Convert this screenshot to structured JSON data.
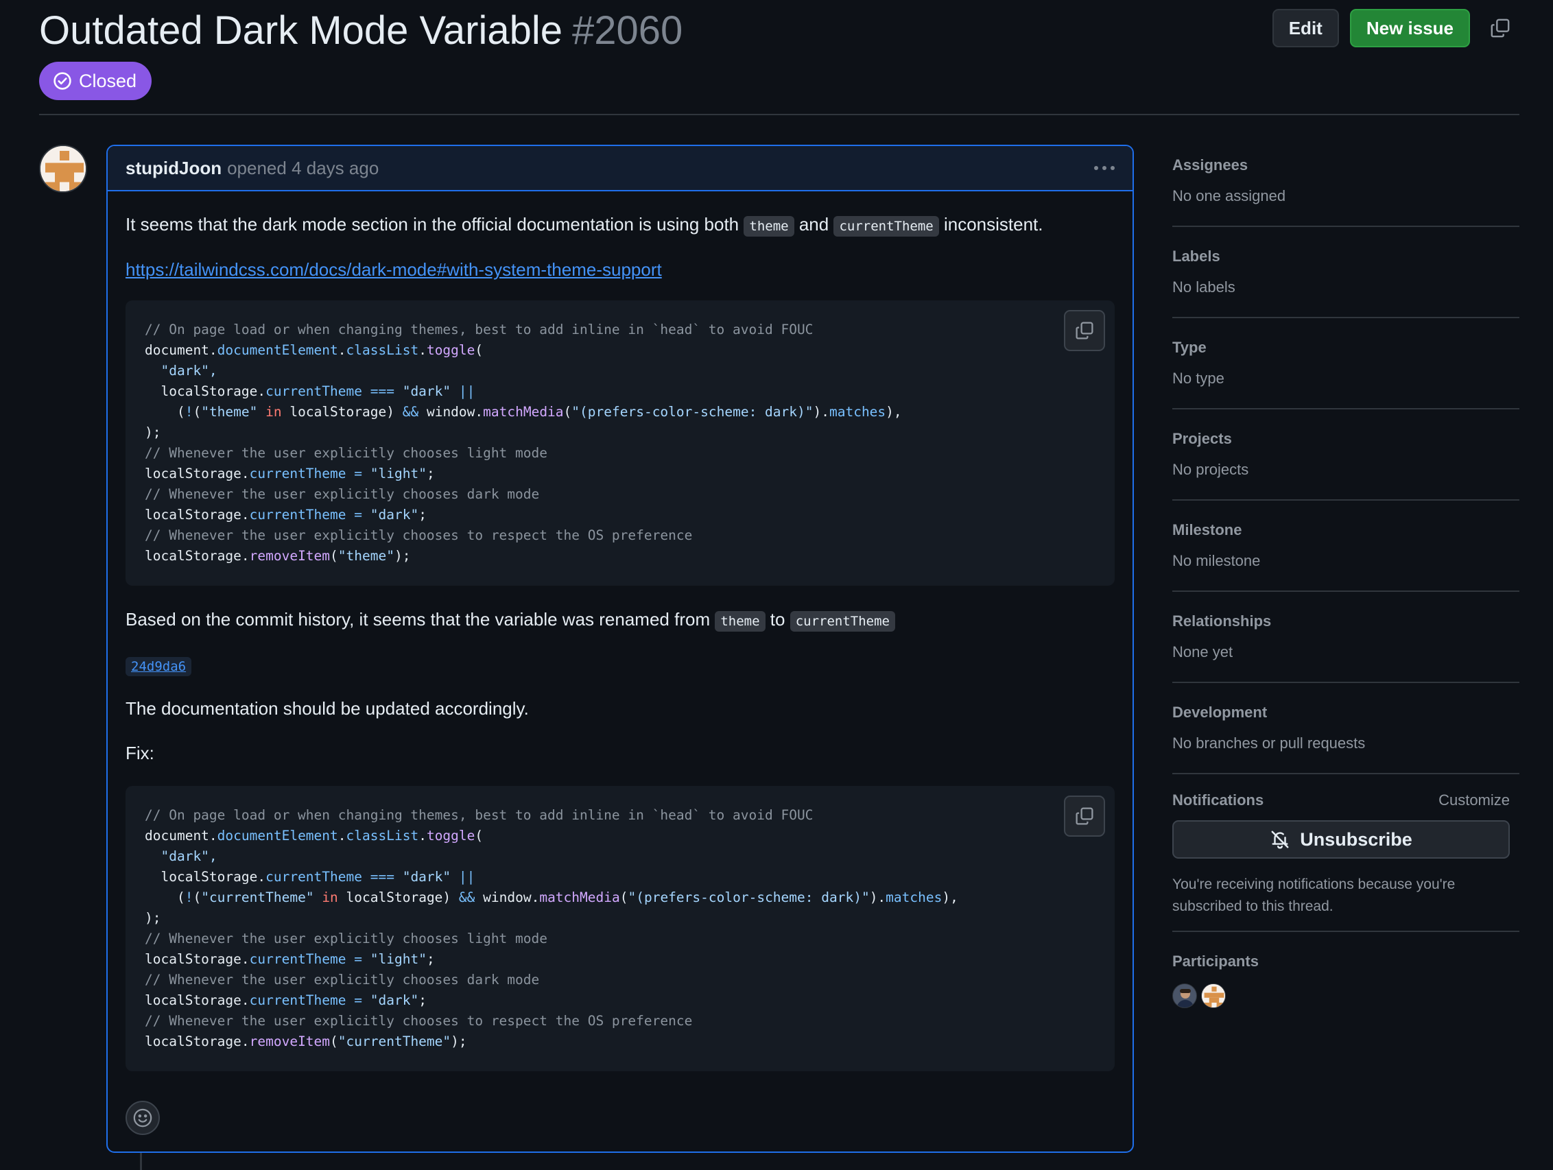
{
  "issue": {
    "title": "Outdated Dark Mode Variable",
    "number": "#2060",
    "state": "Closed",
    "state_color": "#8957e5"
  },
  "header_actions": {
    "edit_label": "Edit",
    "new_issue_label": "New issue"
  },
  "comment": {
    "author": "stupidJoon",
    "meta": "opened 4 days ago",
    "p1_before": "It seems that the dark mode section in the official documentation is using both",
    "p1_code1": "theme",
    "p1_mid": "and",
    "p1_code2": "currentTheme",
    "p1_after": "inconsistent.",
    "link": "https://tailwindcss.com/docs/dark-mode#with-system-theme-support",
    "code1": {
      "l1": "// On page load or when changing themes, best to add inline in `head` to avoid FOUC",
      "l2a": "document.",
      "l2b": "documentElement",
      "l2c": ".",
      "l2d": "classList",
      "l2e": ".",
      "l2f": "toggle",
      "l2g": "(",
      "l3": "  \"dark\",",
      "l4a": "  localStorage.",
      "l4b": "currentTheme",
      "l4c": " === ",
      "l4d": "\"dark\"",
      "l4e": " ||",
      "l5a": "    (",
      "l5b": "!",
      "l5c": "(",
      "l5d": "\"theme\"",
      "l5e": " in ",
      "l5f": "localStorage) ",
      "l5g": "&&",
      "l5h": " window.",
      "l5i": "matchMedia",
      "l5j": "(",
      "l5k": "\"(prefers-color-scheme: dark)\"",
      "l5l": ").",
      "l5m": "matches",
      "l5n": "),",
      "l6": ");",
      "l7": "// Whenever the user explicitly chooses light mode",
      "l8a": "localStorage.",
      "l8b": "currentTheme",
      "l8c": " = ",
      "l8d": "\"light\"",
      "l8e": ";",
      "l9": "// Whenever the user explicitly chooses dark mode",
      "l10a": "localStorage.",
      "l10b": "currentTheme",
      "l10c": " = ",
      "l10d": "\"dark\"",
      "l10e": ";",
      "l11": "// Whenever the user explicitly chooses to respect the OS preference",
      "l12a": "localStorage.",
      "l12b": "removeItem",
      "l12c": "(",
      "l12d": "\"theme\"",
      "l12e": ");"
    },
    "p2_before": "Based on the commit history, it seems that the variable was renamed from",
    "p2_code1": "theme",
    "p2_mid": "to",
    "p2_code2": "currentTheme",
    "commit_sha": "24d9da6",
    "p3": "The documentation should be updated accordingly.",
    "p4": "Fix:",
    "code2": {
      "l1": "// On page load or when changing themes, best to add inline in `head` to avoid FOUC",
      "l2a": "document.",
      "l2b": "documentElement",
      "l2c": ".",
      "l2d": "classList",
      "l2e": ".",
      "l2f": "toggle",
      "l2g": "(",
      "l3": "  \"dark\",",
      "l4a": "  localStorage.",
      "l4b": "currentTheme",
      "l4c": " === ",
      "l4d": "\"dark\"",
      "l4e": " ||",
      "l5a": "    (",
      "l5b": "!",
      "l5c": "(",
      "l5d": "\"currentTheme\"",
      "l5e": " in ",
      "l5f": "localStorage) ",
      "l5g": "&&",
      "l5h": " window.",
      "l5i": "matchMedia",
      "l5j": "(",
      "l5k": "\"(prefers-color-scheme: dark)\"",
      "l5l": ").",
      "l5m": "matches",
      "l5n": "),",
      "l6": ");",
      "l7": "// Whenever the user explicitly chooses light mode",
      "l8a": "localStorage.",
      "l8b": "currentTheme",
      "l8c": " = ",
      "l8d": "\"light\"",
      "l8e": ";",
      "l9": "// Whenever the user explicitly chooses dark mode",
      "l10a": "localStorage.",
      "l10b": "currentTheme",
      "l10c": " = ",
      "l10d": "\"dark\"",
      "l10e": ";",
      "l11": "// Whenever the user explicitly chooses to respect the OS preference",
      "l12a": "localStorage.",
      "l12b": "removeItem",
      "l12c": "(",
      "l12d": "\"currentTheme\"",
      "l12e": ");"
    }
  },
  "sidebar": {
    "assignees": {
      "title": "Assignees",
      "value": "No one assigned"
    },
    "labels": {
      "title": "Labels",
      "value": "No labels"
    },
    "type": {
      "title": "Type",
      "value": "No type"
    },
    "projects": {
      "title": "Projects",
      "value": "No projects"
    },
    "milestone": {
      "title": "Milestone",
      "value": "No milestone"
    },
    "relationships": {
      "title": "Relationships",
      "value": "None yet"
    },
    "development": {
      "title": "Development",
      "value": "No branches or pull requests"
    },
    "notifications": {
      "title": "Notifications",
      "customize": "Customize",
      "unsubscribe": "Unsubscribe",
      "reason": "You're receiving notifications because you're subscribed to this thread."
    },
    "participants": {
      "title": "Participants"
    }
  },
  "colors": {
    "background": "#0d1117",
    "accent_blue": "#1f6feb",
    "link": "#4493f8",
    "green": "#238636"
  }
}
